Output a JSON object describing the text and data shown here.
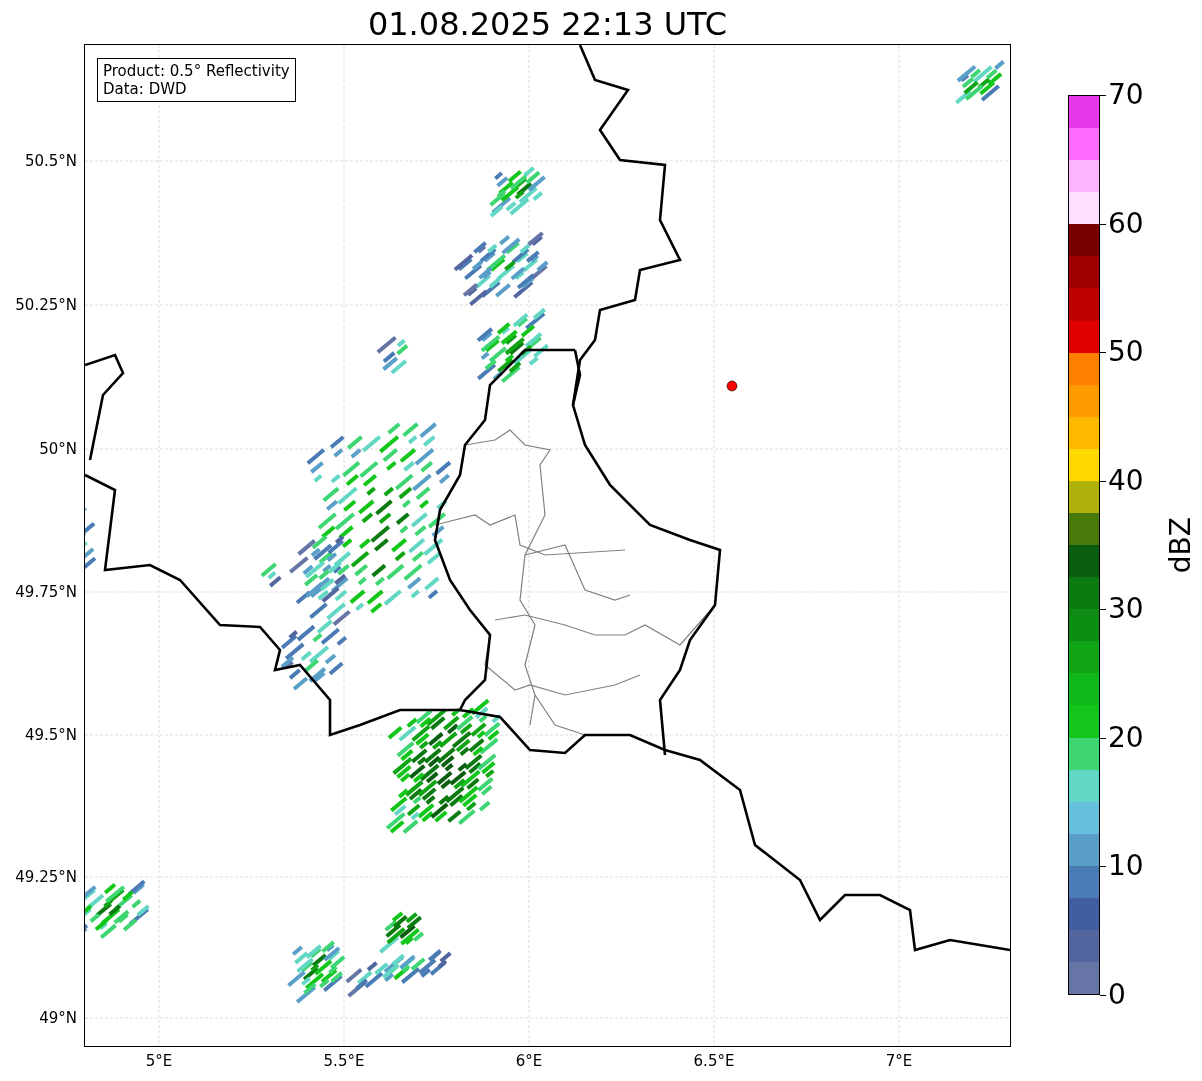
{
  "title": "01.08.2025 22:13 UTC",
  "info_box": {
    "lines": [
      "Product: 0.5° Reflectivity",
      "Data: DWD"
    ]
  },
  "map": {
    "x_ticks": [
      "5°E",
      "5.5°E",
      "6°E",
      "6.5°E",
      "7°E"
    ],
    "y_ticks": [
      "50.5°N",
      "50.25°N",
      "50°N",
      "49.75°N",
      "49.5°N",
      "49.25°N",
      "49°N"
    ]
  },
  "colorbar": {
    "label": "dBZ",
    "ticks": [
      "70",
      "60",
      "50",
      "40",
      "30",
      "20",
      "10",
      "0"
    ],
    "segments": [
      {
        "color": "#e838ee"
      },
      {
        "color": "#ff6cff"
      },
      {
        "color": "#ffb4ff"
      },
      {
        "color": "#ffe0ff"
      },
      {
        "color": "#780000"
      },
      {
        "color": "#a00000"
      },
      {
        "color": "#c00000"
      },
      {
        "color": "#e00000"
      },
      {
        "color": "#ff8000"
      },
      {
        "color": "#ff9a00"
      },
      {
        "color": "#ffb800"
      },
      {
        "color": "#ffd800"
      },
      {
        "color": "#b0b00a"
      },
      {
        "color": "#4a7a0c"
      },
      {
        "color": "#0a5e10"
      },
      {
        "color": "#0b7a10"
      },
      {
        "color": "#0c8c12"
      },
      {
        "color": "#10a514"
      },
      {
        "color": "#10b91a"
      },
      {
        "color": "#12c71a"
      },
      {
        "color": "#3dd672"
      },
      {
        "color": "#62d8c4"
      },
      {
        "color": "#66c2dc"
      },
      {
        "color": "#5a9fc8"
      },
      {
        "color": "#4a7bb4"
      },
      {
        "color": "#425da0"
      },
      {
        "color": "#5466a0"
      },
      {
        "color": "#6674a6"
      }
    ]
  }
}
